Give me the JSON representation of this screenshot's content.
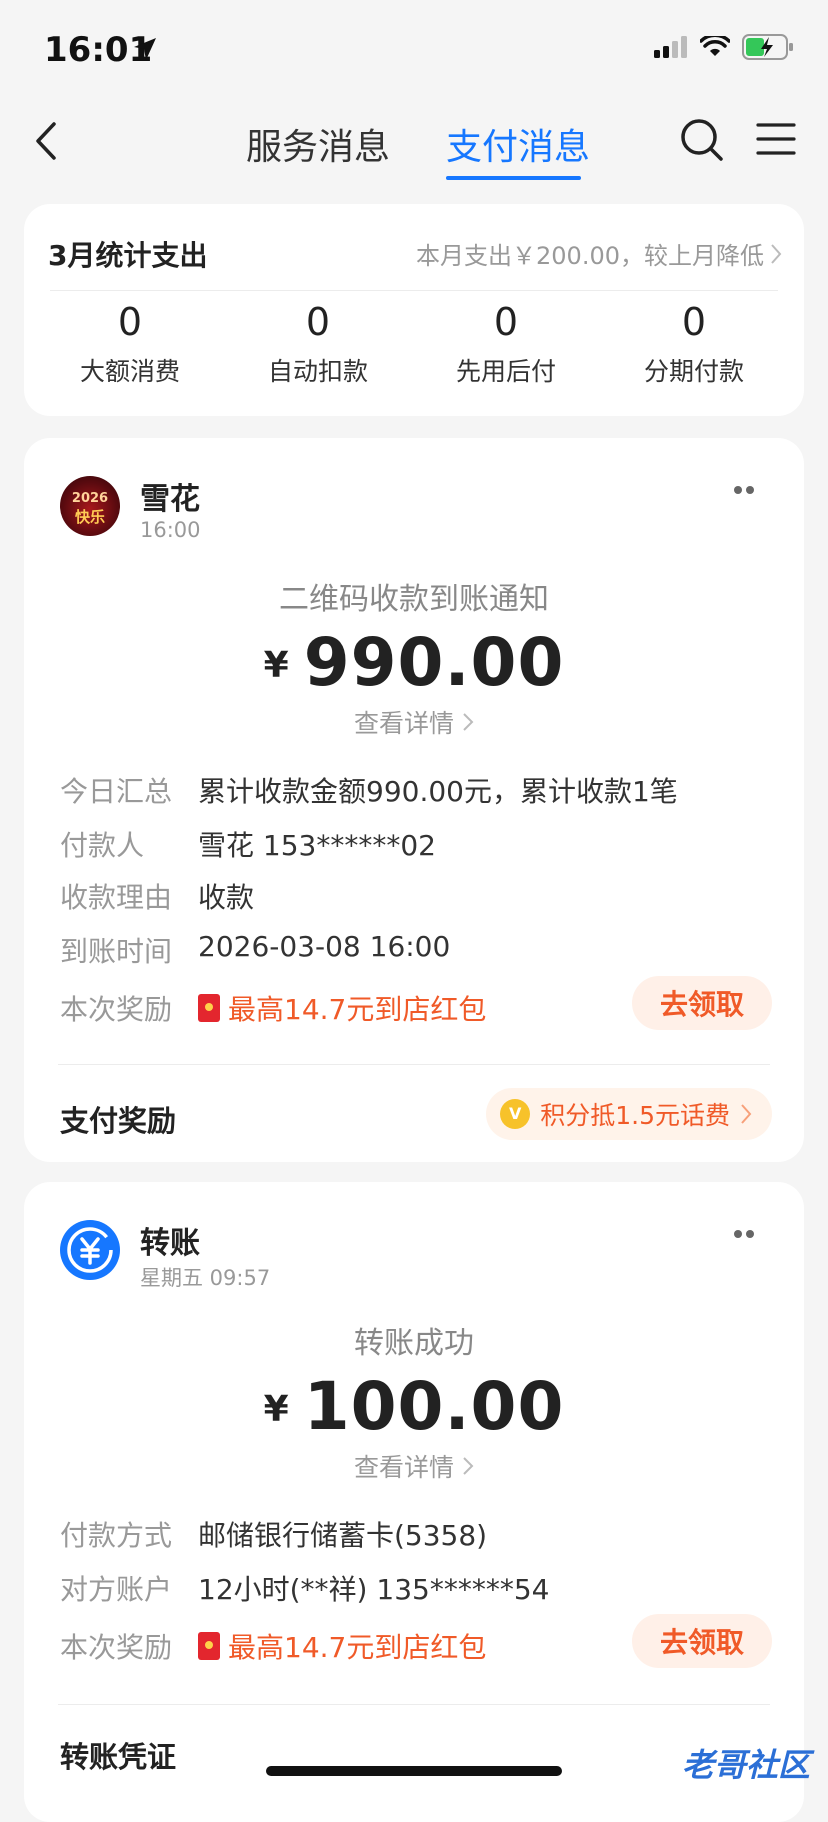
{
  "status_bar": {
    "time": "16:01"
  },
  "nav": {
    "tab_service": "服务消息",
    "tab_pay": "支付消息"
  },
  "stats": {
    "title": "3月统计支出",
    "summary": "本月支出￥200.00，较上月降低",
    "items": [
      {
        "value": "0",
        "label": "大额消费"
      },
      {
        "value": "0",
        "label": "自动扣款"
      },
      {
        "value": "0",
        "label": "先用后付"
      },
      {
        "value": "0",
        "label": "分期付款"
      }
    ]
  },
  "message1": {
    "sender": "雪花",
    "time": "16:00",
    "avatar_text": "2026 快乐",
    "title": "二维码收款到账通知",
    "currency": "¥",
    "amount": "990.00",
    "detail_link": "查看详情",
    "rows": [
      {
        "label": "今日汇总",
        "value": "累计收款金额990.00元，累计收款1笔"
      },
      {
        "label": "付款人",
        "value": "雪花 153******02"
      },
      {
        "label": "收款理由",
        "value": "收款"
      },
      {
        "label": "到账时间",
        "value": "2026-03-08 16:00"
      }
    ],
    "reward_label": "本次奖励",
    "reward_value": "最高14.7元到店红包",
    "claim_button": "去领取",
    "section_label": "支付奖励",
    "points_text": "积分抵1.5元话费"
  },
  "message2": {
    "sender": "转账",
    "time": "星期五 09:57",
    "title": "转账成功",
    "currency": "¥",
    "amount": "100.00",
    "detail_link": "查看详情",
    "rows": [
      {
        "label": "付款方式",
        "value": "邮储银行储蓄卡(5358)"
      },
      {
        "label": "对方账户",
        "value": "12小时(**祥) 135******54"
      }
    ],
    "reward_label": "本次奖励",
    "reward_value": "最高14.7元到店红包",
    "claim_button": "去领取",
    "section_label": "转账凭证"
  },
  "watermark": "老哥社区",
  "colors": {
    "accent": "#1677ff",
    "reward": "#f05a28",
    "background": "#f5f5f5"
  }
}
